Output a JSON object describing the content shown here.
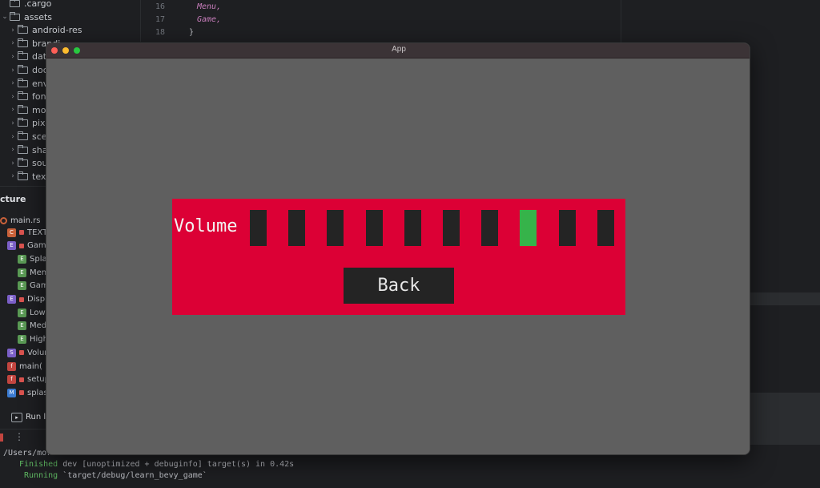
{
  "project_tree": [
    {
      "label": ".cargo",
      "chevron": ""
    },
    {
      "label": "assets",
      "chevron": "⌄"
    },
    {
      "label": "android-res",
      "chevron": "›"
    },
    {
      "label": "brandi",
      "chevron": "›"
    },
    {
      "label": "data",
      "chevron": "›"
    },
    {
      "label": "docs",
      "chevron": "›"
    },
    {
      "label": "envir",
      "chevron": "›"
    },
    {
      "label": "fonts",
      "chevron": "›"
    },
    {
      "label": "mode",
      "chevron": "›"
    },
    {
      "label": "pixel",
      "chevron": "›"
    },
    {
      "label": "scene",
      "chevron": "›"
    },
    {
      "label": "shade",
      "chevron": "›"
    },
    {
      "label": "soun",
      "chevron": "›"
    },
    {
      "label": "textu",
      "chevron": "›"
    }
  ],
  "editor": {
    "lines": [
      {
        "num": "16",
        "text": "Menu,",
        "plain": false
      },
      {
        "num": "17",
        "text": "Game,",
        "plain": false
      },
      {
        "num": "18",
        "text": "}",
        "plain": true
      }
    ]
  },
  "structure": {
    "title": "cture",
    "file": "main.rs",
    "items": [
      {
        "badge": "C",
        "color": "#c9613a",
        "lock": true,
        "label": "TEXT_"
      },
      {
        "badge": "E",
        "color": "#7b5fc7",
        "lock": true,
        "label": "Game"
      },
      {
        "badge": "E",
        "color": "#5a9a55",
        "lock": false,
        "label": "Splas"
      },
      {
        "badge": "E",
        "color": "#5a9a55",
        "lock": false,
        "label": "Menu"
      },
      {
        "badge": "E",
        "color": "#5a9a55",
        "lock": false,
        "label": "Game"
      },
      {
        "badge": "E",
        "color": "#7b5fc7",
        "lock": true,
        "label": "Displa"
      },
      {
        "badge": "E",
        "color": "#5a9a55",
        "lock": false,
        "label": "Low"
      },
      {
        "badge": "E",
        "color": "#5a9a55",
        "lock": false,
        "label": "Medi"
      },
      {
        "badge": "E",
        "color": "#5a9a55",
        "lock": false,
        "label": "High"
      },
      {
        "badge": "S",
        "color": "#7b5fc7",
        "lock": true,
        "label": "Volum"
      },
      {
        "badge": "f",
        "color": "#c2453f",
        "lock": false,
        "label": "main("
      },
      {
        "badge": "f",
        "color": "#c2453f",
        "lock": true,
        "label": "setup"
      },
      {
        "badge": "M",
        "color": "#3b7bd1",
        "lock": true,
        "label": "splash"
      }
    ]
  },
  "run": {
    "tab_label": "Run le",
    "more_icon": "⋮"
  },
  "console": {
    "line1": "/Users/mor",
    "line2_status": "Finished",
    "line2_rest": " dev [unoptimized + debuginfo] target(s) in 0.42s",
    "line3_status": "Running",
    "line3_rest": " `target/debug/learn_bevy_game`"
  },
  "app": {
    "title": "App",
    "volume_label": "Volume",
    "volume_level": 8,
    "volume_steps": 10,
    "back_label": "Back",
    "colors": {
      "panel": "#dc0035",
      "button": "#242424",
      "active": "#36b34a",
      "background": "#5f5f5f"
    }
  }
}
